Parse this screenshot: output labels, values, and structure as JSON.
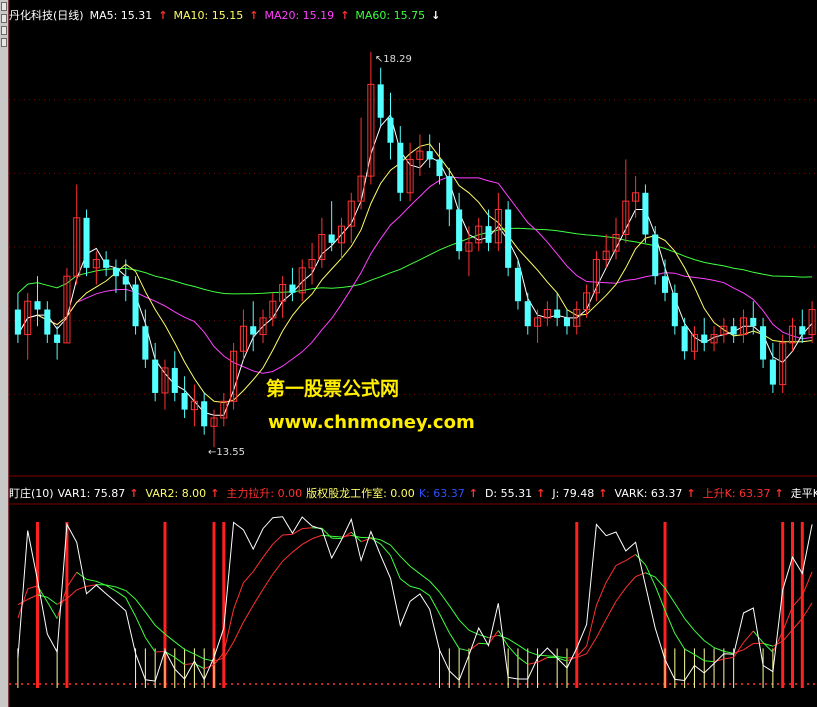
{
  "stock_title": "丹化科技(日线)",
  "main_legend": [
    {
      "label": "MA5:",
      "value": "15.31",
      "arrow": "↑",
      "color": "#ffffff",
      "arrow_color": "#ff3030"
    },
    {
      "label": "MA10:",
      "value": "15.15",
      "arrow": "↑",
      "color": "#ffff66",
      "arrow_color": "#ff3030"
    },
    {
      "label": "MA20:",
      "value": "15.19",
      "arrow": "↑",
      "color": "#ff40ff",
      "arrow_color": "#ff3030"
    },
    {
      "label": "MA60:",
      "value": "15.75",
      "arrow": "↓",
      "color": "#40ff40",
      "arrow_color": "#ffffff"
    }
  ],
  "high_marker": "18.29",
  "low_marker": "13.55",
  "watermark": {
    "line1": "第一股票公式网",
    "line2": "www.chnmoney.com"
  },
  "indicator_legend": [
    {
      "text": "盯庄(10)",
      "color": "#ffffff"
    },
    {
      "text": "VAR1: 75.87",
      "arrow": "↑",
      "color": "#ffffff"
    },
    {
      "text": "VAR2: 8.00",
      "arrow": "↑",
      "color": "#ffff66"
    },
    {
      "text": "主力拉升: 0.00",
      "color": "#ff3030"
    },
    {
      "text": "版权股龙工作室: 0.00",
      "color": "#ffff66"
    },
    {
      "text": "K: 63.37",
      "arrow": "↑",
      "color": "#3050ff"
    },
    {
      "text": "D: 55.31",
      "arrow": "↑",
      "color": "#ffffff"
    },
    {
      "text": "J: 79.48",
      "arrow": "↑",
      "color": "#ffffff"
    },
    {
      "text": "VARK: 63.37",
      "arrow": "↑",
      "color": "#ffffff"
    },
    {
      "text": "上升K: 63.37",
      "arrow": "↑",
      "color": "#ff3030"
    },
    {
      "text": "走平K: -",
      "color": "#ffffff"
    }
  ],
  "colors": {
    "up": "#ff3232",
    "down": "#54ffff",
    "ma5": "#ffffff",
    "ma10": "#ffff66",
    "ma20": "#ff40ff",
    "ma60": "#40ff40",
    "grid": "#800000",
    "signal": "#ff2020"
  },
  "chart_data": [
    {
      "type": "candlestick",
      "title": "丹化科技(日线)",
      "ylim": [
        13.3,
        18.6
      ],
      "candles": [
        [
          15.2,
          15.4,
          14.8,
          14.9
        ],
        [
          14.9,
          15.4,
          14.6,
          15.3
        ],
        [
          15.3,
          15.6,
          15.0,
          15.2
        ],
        [
          15.2,
          15.3,
          14.8,
          14.9
        ],
        [
          14.9,
          15.0,
          14.6,
          14.8
        ],
        [
          14.8,
          15.7,
          14.8,
          15.6
        ],
        [
          15.6,
          16.7,
          15.5,
          16.3
        ],
        [
          16.3,
          16.4,
          15.6,
          15.7
        ],
        [
          15.7,
          15.9,
          15.5,
          15.8
        ],
        [
          15.8,
          15.9,
          15.6,
          15.7
        ],
        [
          15.7,
          15.8,
          15.4,
          15.6
        ],
        [
          15.6,
          15.8,
          15.3,
          15.5
        ],
        [
          15.5,
          15.6,
          14.9,
          15.0
        ],
        [
          15.0,
          15.2,
          14.5,
          14.6
        ],
        [
          14.6,
          14.8,
          14.1,
          14.2
        ],
        [
          14.2,
          14.6,
          14.0,
          14.5
        ],
        [
          14.5,
          14.7,
          14.1,
          14.2
        ],
        [
          14.2,
          14.4,
          13.9,
          14.0
        ],
        [
          14.0,
          14.3,
          13.8,
          14.1
        ],
        [
          14.1,
          14.2,
          13.7,
          13.8
        ],
        [
          13.8,
          14.0,
          13.55,
          13.9
        ],
        [
          13.9,
          14.2,
          13.8,
          14.1
        ],
        [
          14.1,
          14.8,
          14.0,
          14.7
        ],
        [
          14.7,
          15.2,
          14.6,
          15.0
        ],
        [
          15.0,
          15.3,
          14.7,
          14.9
        ],
        [
          14.9,
          15.2,
          14.8,
          15.1
        ],
        [
          15.1,
          15.4,
          15.0,
          15.3
        ],
        [
          15.3,
          15.6,
          15.1,
          15.5
        ],
        [
          15.5,
          15.7,
          15.3,
          15.4
        ],
        [
          15.4,
          15.8,
          15.3,
          15.7
        ],
        [
          15.7,
          16.0,
          15.5,
          15.8
        ],
        [
          15.8,
          16.3,
          15.7,
          16.1
        ],
        [
          16.1,
          16.5,
          15.9,
          16.0
        ],
        [
          16.0,
          16.3,
          15.8,
          16.2
        ],
        [
          16.2,
          16.6,
          16.0,
          16.5
        ],
        [
          16.5,
          17.5,
          16.4,
          16.8
        ],
        [
          16.8,
          18.29,
          16.7,
          17.9
        ],
        [
          17.9,
          18.1,
          17.4,
          17.5
        ],
        [
          17.5,
          17.8,
          17.0,
          17.2
        ],
        [
          17.2,
          17.4,
          16.5,
          16.6
        ],
        [
          16.6,
          17.2,
          16.5,
          17.0
        ],
        [
          17.0,
          17.3,
          16.8,
          17.1
        ],
        [
          17.1,
          17.3,
          16.9,
          17.0
        ],
        [
          17.0,
          17.2,
          16.7,
          16.8
        ],
        [
          16.8,
          16.9,
          16.2,
          16.4
        ],
        [
          16.4,
          16.6,
          15.8,
          15.9
        ],
        [
          15.9,
          16.2,
          15.6,
          16.0
        ],
        [
          16.0,
          16.3,
          15.9,
          16.2
        ],
        [
          16.2,
          16.4,
          15.9,
          16.0
        ],
        [
          16.0,
          16.6,
          15.9,
          16.4
        ],
        [
          16.4,
          16.5,
          15.6,
          15.7
        ],
        [
          15.7,
          15.8,
          15.2,
          15.3
        ],
        [
          15.3,
          15.4,
          14.9,
          15.0
        ],
        [
          15.0,
          15.2,
          14.8,
          15.1
        ],
        [
          15.1,
          15.3,
          15.0,
          15.2
        ],
        [
          15.2,
          15.4,
          15.0,
          15.1
        ],
        [
          15.1,
          15.2,
          14.9,
          15.0
        ],
        [
          15.0,
          15.3,
          14.9,
          15.2
        ],
        [
          15.2,
          15.5,
          15.1,
          15.4
        ],
        [
          15.4,
          15.9,
          15.3,
          15.8
        ],
        [
          15.8,
          16.1,
          15.7,
          15.9
        ],
        [
          15.9,
          16.3,
          15.8,
          16.1
        ],
        [
          16.1,
          17.0,
          16.0,
          16.5
        ],
        [
          16.5,
          16.8,
          16.3,
          16.6
        ],
        [
          16.6,
          16.7,
          16.0,
          16.1
        ],
        [
          16.1,
          16.2,
          15.5,
          15.6
        ],
        [
          15.6,
          15.8,
          15.3,
          15.4
        ],
        [
          15.4,
          15.5,
          14.9,
          15.0
        ],
        [
          15.0,
          15.1,
          14.6,
          14.7
        ],
        [
          14.7,
          15.0,
          14.6,
          14.9
        ],
        [
          14.9,
          15.1,
          14.7,
          14.8
        ],
        [
          14.8,
          15.0,
          14.7,
          14.9
        ],
        [
          14.9,
          15.1,
          14.8,
          15.0
        ],
        [
          15.0,
          15.1,
          14.8,
          14.9
        ],
        [
          14.9,
          15.2,
          14.8,
          15.1
        ],
        [
          15.1,
          15.3,
          14.9,
          15.0
        ],
        [
          15.0,
          15.1,
          14.5,
          14.6
        ],
        [
          14.6,
          14.8,
          14.2,
          14.3
        ],
        [
          14.3,
          14.9,
          14.2,
          14.8
        ],
        [
          14.8,
          15.1,
          14.7,
          15.0
        ],
        [
          15.0,
          15.2,
          14.8,
          14.9
        ],
        [
          14.9,
          15.3,
          14.8,
          15.2
        ]
      ]
    },
    {
      "type": "line",
      "title": "盯庄(10)",
      "ylim": [
        0,
        100
      ],
      "series": [
        {
          "name": "VAR1",
          "color": "#ffffff"
        },
        {
          "name": "K",
          "color": "#ff3030"
        },
        {
          "name": "D",
          "color": "#ff3030"
        }
      ],
      "signals": [
        2,
        5,
        15,
        20,
        21,
        57,
        66,
        78,
        79,
        80
      ]
    }
  ]
}
